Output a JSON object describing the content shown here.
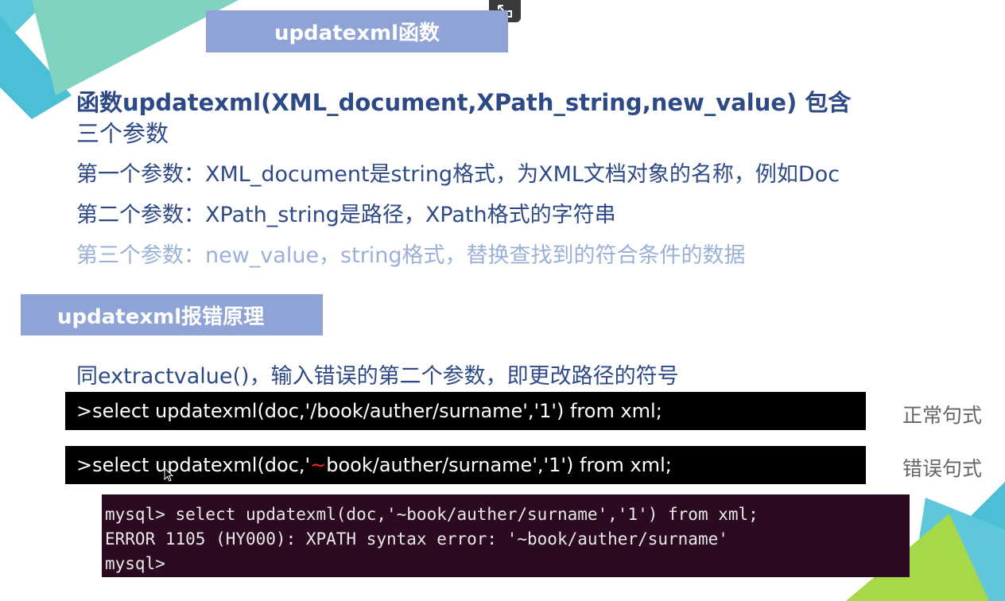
{
  "header1": "updatexml函数",
  "header2": "updatexml报错原理",
  "intro_line1": "函数updatexml(XML_document,XPath_string,new_value)  包含",
  "intro_line2": "三个参数",
  "param1": "第一个参数：XML_document是string格式，为XML文档对象的名称，例如Doc",
  "param2": "第二个参数：XPath_string是路径，XPath格式的字符串",
  "param3": "第三个参数：new_value，string格式，替换查找到的符合条件的数据",
  "principle": "同extractvalue()，输入错误的第二个参数，即更改路径的符号",
  "normal_cmd": ">select updatexml(doc,'/book/auther/surname','1') from xml;",
  "normal_label": "正常句式",
  "error_cmd_prefix": ">select updatexml(doc,'",
  "error_cmd_tilde": "~",
  "error_cmd_suffix": "book/auther/surname','1') from xml;",
  "error_label": "错误句式",
  "terminal": {
    "line1": "mysql> select updatexml(doc,'~book/auther/surname','1') from xml;",
    "line2": "ERROR 1105 (HY000): XPATH syntax error: '~book/auther/surname'",
    "line3": "mysql>"
  },
  "colors": {
    "header_bg": "#8fa3d6",
    "text_blue": "#2e4a86",
    "faded_blue": "#9bb0d6",
    "terminal_bg": "#2b0a22",
    "tilde_red": "#ff2a2a"
  }
}
